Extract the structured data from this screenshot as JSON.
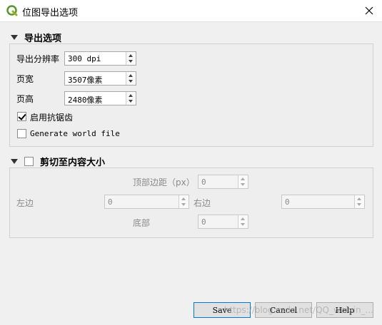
{
  "window": {
    "title": "位图导出选项",
    "icon": "qgis-q-icon",
    "close": "×"
  },
  "export_options": {
    "header": "导出选项",
    "resolution_label": "导出分辨率",
    "resolution_value": "300 dpi",
    "width_label": "页宽",
    "width_value": "3507像素",
    "height_label": "页高",
    "height_value": "2480像素",
    "antialias_label": "启用抗锯齿",
    "antialias_checked": true,
    "world_file_label": "Generate world file",
    "world_file_checked": false
  },
  "crop": {
    "header": "剪切至内容大小",
    "checked": false,
    "top_label": "顶部边距（px）",
    "top_value": "0",
    "left_label": "左边",
    "left_value": "0",
    "right_label": "右边",
    "right_value": "0",
    "bottom_label": "底部",
    "bottom_value": "0"
  },
  "buttons": {
    "save": "Save",
    "cancel": "Cancel",
    "help": "Help"
  },
  "watermark": "https://blog.csdn.net/QQ_weixin_..."
}
